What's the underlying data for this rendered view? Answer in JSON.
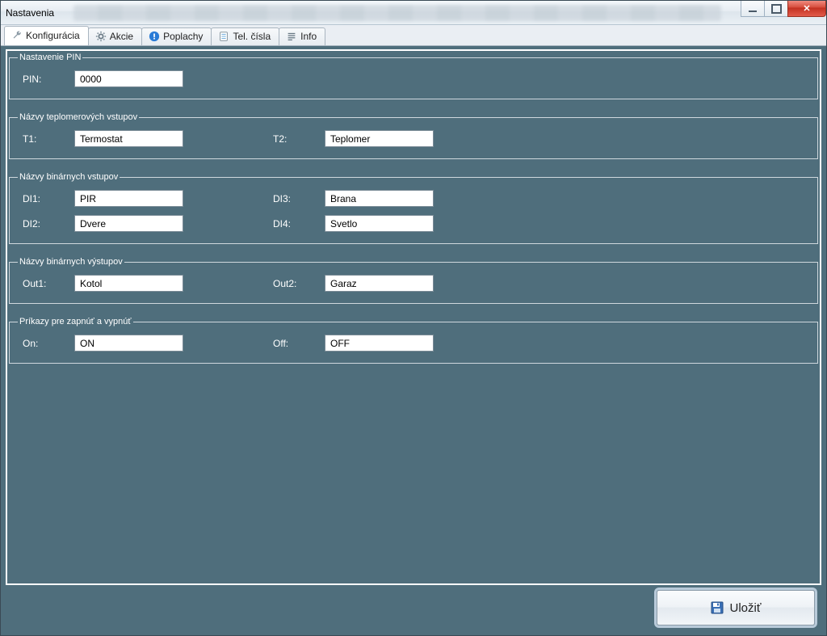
{
  "window": {
    "title": "Nastavenia"
  },
  "tabs": [
    {
      "label": "Konfigurácia",
      "icon": "wrench"
    },
    {
      "label": "Akcie",
      "icon": "gear"
    },
    {
      "label": "Poplachy",
      "icon": "alert"
    },
    {
      "label": "Tel. čísla",
      "icon": "phone-list"
    },
    {
      "label": "Info",
      "icon": "lines"
    }
  ],
  "groups": {
    "pin": {
      "legend": "Nastavenie PIN",
      "pin_label": "PIN:",
      "pin_value": "0000"
    },
    "temp": {
      "legend": "Názvy teplomerových vstupov",
      "t1_label": "T1:",
      "t1_value": "Termostat",
      "t2_label": "T2:",
      "t2_value": "Teplomer"
    },
    "din": {
      "legend": "Názvy binárnych vstupov",
      "di1_label": "DI1:",
      "di1_value": "PIR",
      "di2_label": "DI2:",
      "di2_value": "Dvere",
      "di3_label": "DI3:",
      "di3_value": "Brana",
      "di4_label": "DI4:",
      "di4_value": "Svetlo"
    },
    "dout": {
      "legend": "Názvy binárnych výstupov",
      "o1_label": "Out1:",
      "o1_value": "Kotol",
      "o2_label": "Out2:",
      "o2_value": "Garaz"
    },
    "cmd": {
      "legend": "Príkazy pre zapnúť a vypnúť",
      "on_label": "On:",
      "on_value": "ON",
      "off_label": "Off:",
      "off_value": "OFF"
    }
  },
  "footer": {
    "save_label": "Uložiť"
  }
}
